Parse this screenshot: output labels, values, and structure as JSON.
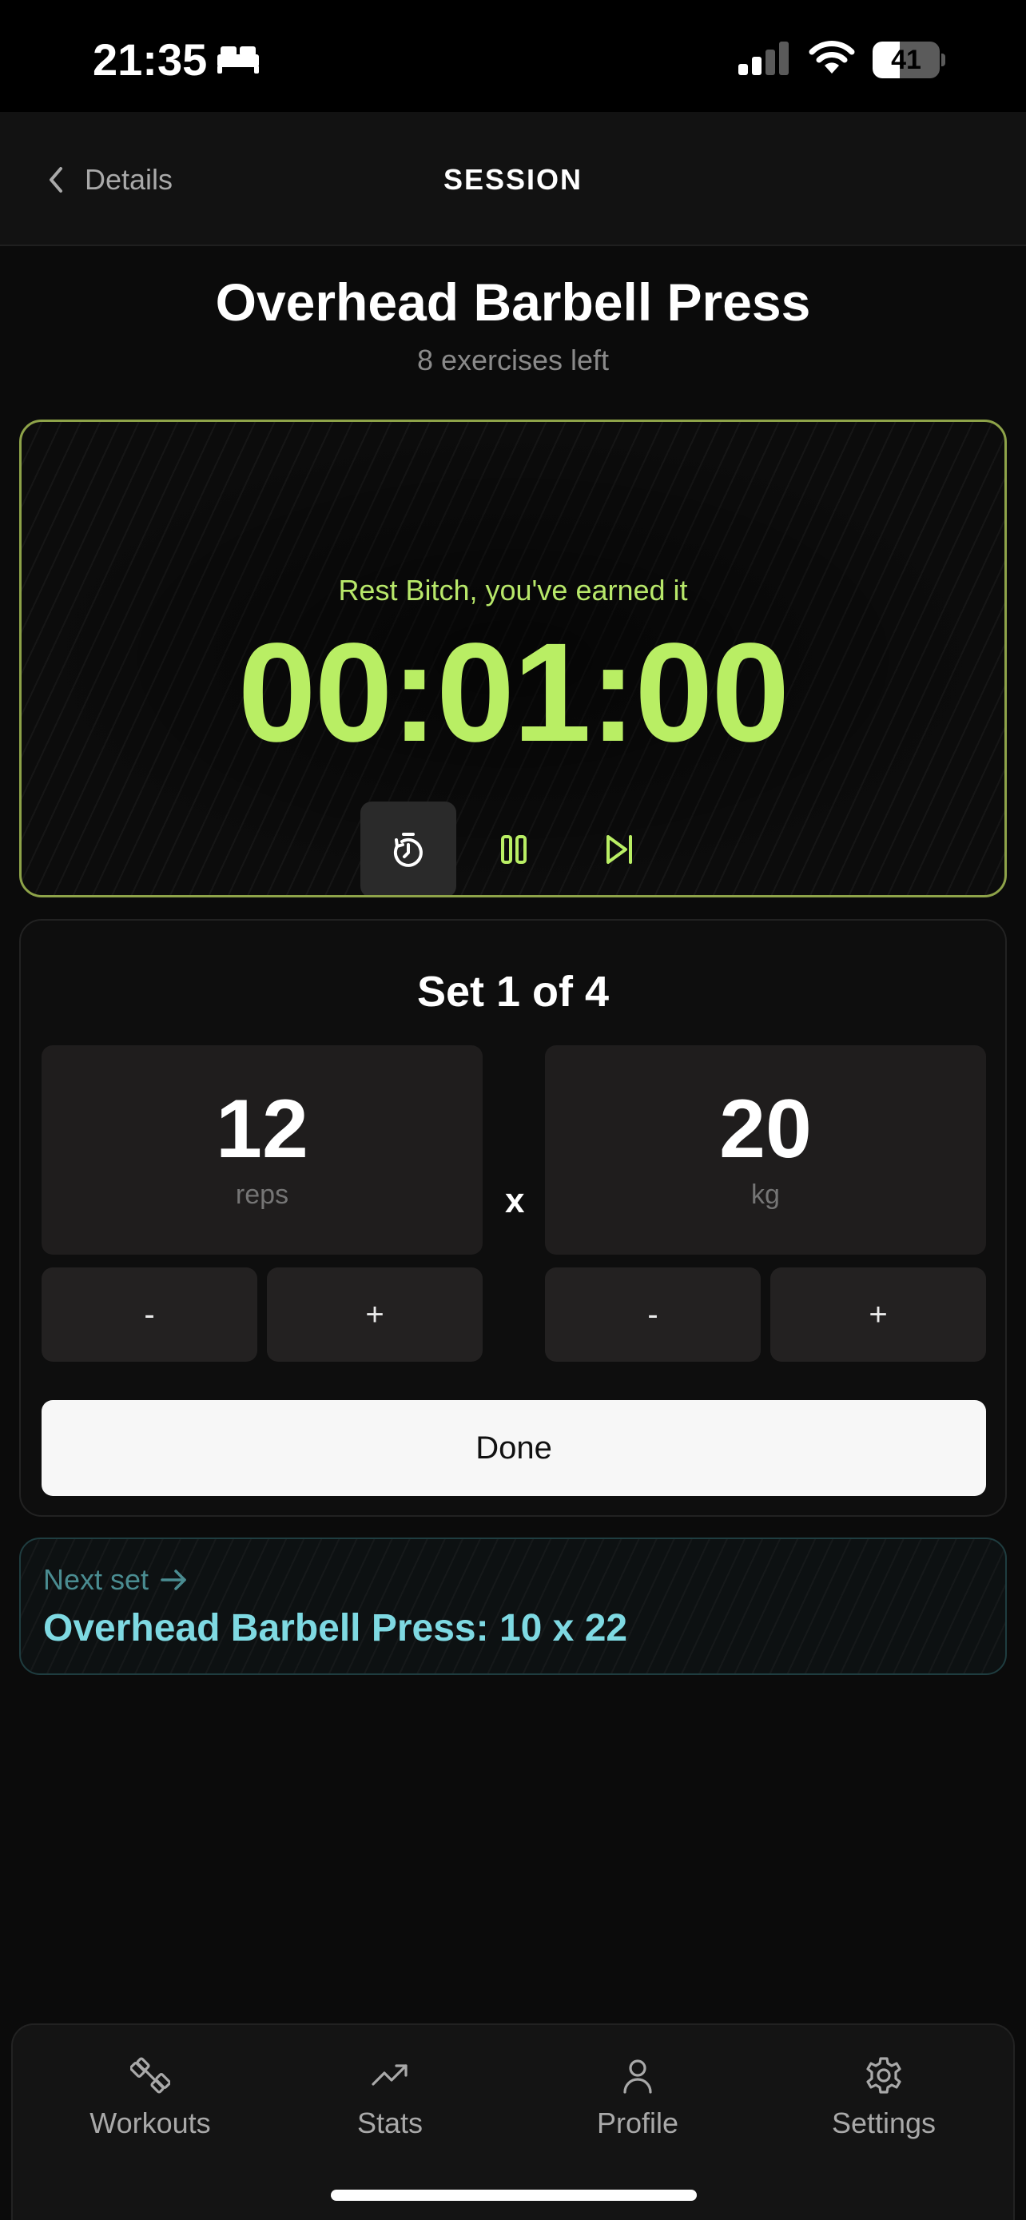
{
  "status_bar": {
    "time": "21:35",
    "battery": "41",
    "battery_level": 0.41,
    "icons": [
      "bed-icon",
      "cellular-signal-icon",
      "wifi-icon",
      "battery-icon"
    ]
  },
  "nav": {
    "back_label": "Details",
    "title": "SESSION"
  },
  "exercise": {
    "title": "Overhead Barbell Press",
    "subtitle": "8 exercises left"
  },
  "timer": {
    "message": "Rest Bitch, you've earned it",
    "value": "00:01:00",
    "accent_color": "#b9ee64",
    "controls": [
      "restart-timer-icon",
      "pause-icon",
      "skip-forward-icon"
    ]
  },
  "set": {
    "title": "Set 1 of 4",
    "reps": {
      "value": "12",
      "unit": "reps"
    },
    "times": "x",
    "weight": {
      "value": "20",
      "unit": "kg"
    },
    "minus_label": "-",
    "plus_label": "+",
    "done_label": "Done"
  },
  "next_set": {
    "label": "Next set",
    "text": "Overhead Barbell Press: 10 x 22",
    "color": "#7ed9e2"
  },
  "tabs": [
    {
      "label": "Workouts",
      "icon": "dumbbell-icon"
    },
    {
      "label": "Stats",
      "icon": "trending-up-icon"
    },
    {
      "label": "Profile",
      "icon": "user-icon"
    },
    {
      "label": "Settings",
      "icon": "gear-icon"
    }
  ]
}
